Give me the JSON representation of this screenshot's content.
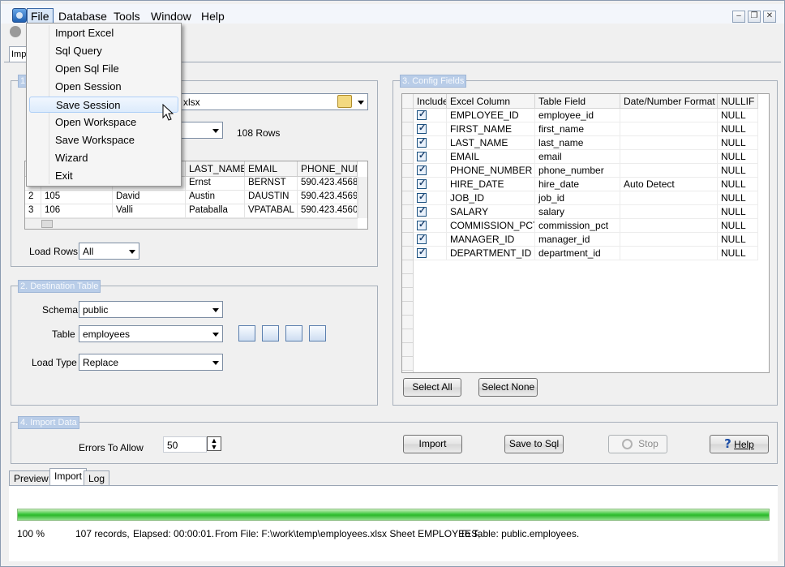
{
  "menubar": {
    "items": [
      "File",
      "Database",
      "Tools",
      "Window",
      "Help"
    ]
  },
  "top_tab": {
    "label": "Imp"
  },
  "file_menu": {
    "items": [
      "Import Excel",
      "Sql Query",
      "Open Sql File",
      "Open Session",
      "Save Session",
      "Open Workspace",
      "Save Workspace",
      "Wizard",
      "Exit"
    ],
    "hovered": "Save Session"
  },
  "source": {
    "title": "1.",
    "file_value": "xlsx",
    "rows_count": "108 Rows",
    "preview": {
      "columns": [
        "",
        "",
        "",
        "LAST_NAME",
        "EMAIL",
        "PHONE_NUM"
      ],
      "rows": [
        [
          "",
          "",
          "",
          "Ernst",
          "BERNST",
          "590.423.4568"
        ],
        [
          "2",
          "105",
          "David",
          "Austin",
          "DAUSTIN",
          "590.423.4569"
        ],
        [
          "3",
          "106",
          "Valli",
          "Pataballa",
          "VPATABAL",
          "590.423.4560"
        ]
      ]
    },
    "load_rows_label": "Load Rows",
    "load_rows_value": "All"
  },
  "destination": {
    "title": "2. Destination Table",
    "schema_label": "Schema",
    "schema_value": "public",
    "table_label": "Table",
    "table_value": "employees",
    "load_type_label": "Load Type",
    "load_type_value": "Replace"
  },
  "config": {
    "title": "3. Config Fields",
    "columns": [
      "Include",
      "Excel Column",
      "Table Field",
      "Date/Number Format",
      "NULLIF"
    ],
    "rows": [
      {
        "excel": "EMPLOYEE_ID",
        "field": "employee_id",
        "format": "",
        "nullif": "NULL"
      },
      {
        "excel": "FIRST_NAME",
        "field": "first_name",
        "format": "",
        "nullif": "NULL"
      },
      {
        "excel": "LAST_NAME",
        "field": "last_name",
        "format": "",
        "nullif": "NULL"
      },
      {
        "excel": "EMAIL",
        "field": "email",
        "format": "",
        "nullif": "NULL"
      },
      {
        "excel": "PHONE_NUMBER",
        "field": "phone_number",
        "format": "",
        "nullif": "NULL"
      },
      {
        "excel": "HIRE_DATE",
        "field": "hire_date",
        "format": "Auto Detect",
        "nullif": "NULL"
      },
      {
        "excel": "JOB_ID",
        "field": "job_id",
        "format": "",
        "nullif": "NULL"
      },
      {
        "excel": "SALARY",
        "field": "salary",
        "format": "",
        "nullif": "NULL"
      },
      {
        "excel": "COMMISSION_PCT",
        "field": "commission_pct",
        "format": "",
        "nullif": "NULL"
      },
      {
        "excel": "MANAGER_ID",
        "field": "manager_id",
        "format": "",
        "nullif": "NULL"
      },
      {
        "excel": "DEPARTMENT_ID",
        "field": "department_id",
        "format": "",
        "nullif": "NULL"
      }
    ],
    "select_all_label": "Select All",
    "select_none_label": "Select None"
  },
  "import_data": {
    "title": "4. Import Data",
    "errors_label": "Errors To Allow",
    "errors_value": "50",
    "import_label": "Import",
    "save_sql_label": "Save to Sql",
    "stop_label": "Stop",
    "help_label": "Help"
  },
  "bottom_tabs": [
    "Preview",
    "Import",
    "Log"
  ],
  "status": {
    "progress_percent": 100,
    "percent_text": "100 %",
    "records": "107 records,",
    "elapsed": "Elapsed: 00:00:01.",
    "from": "From File: F:\\work\\temp\\employees.xlsx Sheet EMPLOYEES,",
    "to": "To Table: public.employees."
  }
}
